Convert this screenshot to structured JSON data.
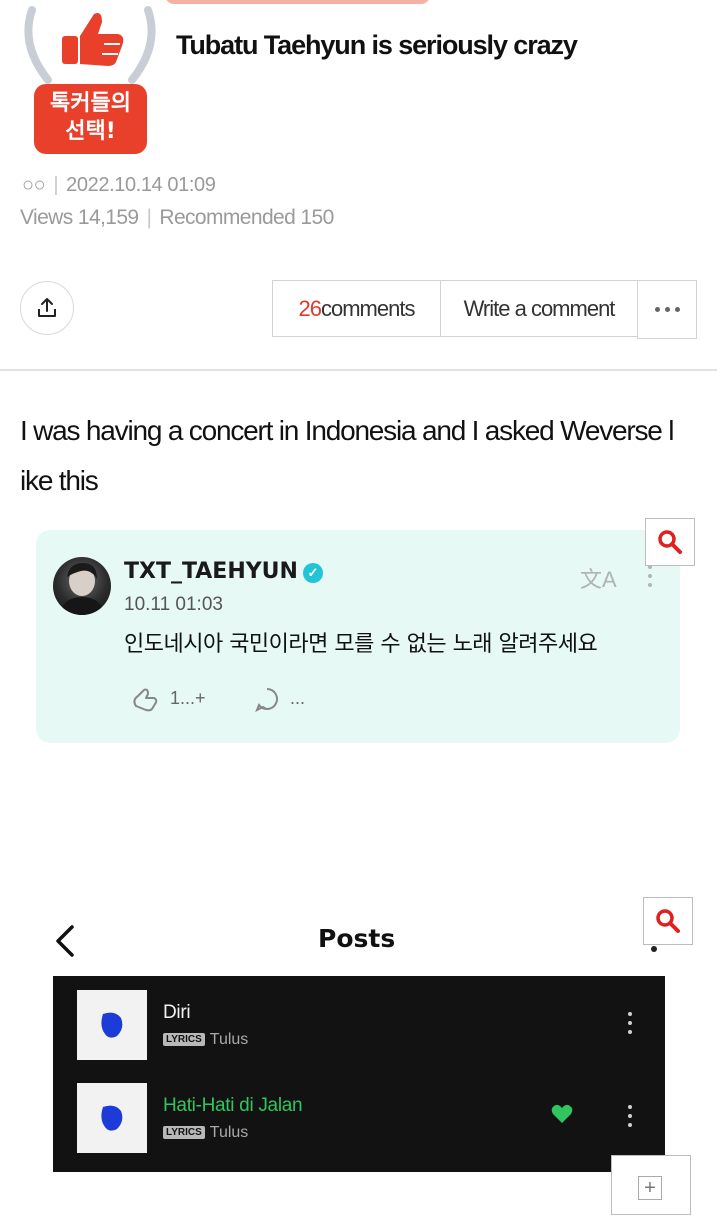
{
  "post": {
    "badge_text_line1": "톡커들의",
    "badge_text_line2": "선택!",
    "title": "Tubatu Taehyun is seriously crazy",
    "author": "○○",
    "datetime": "2022.10.14 01:09",
    "views_label": "Views 14,159",
    "recommended_label": "Recommended 150",
    "body_line1": "I was having a concert in Indonesia and I asked Weverse l",
    "body_line2": "ike this"
  },
  "actions": {
    "comment_count": "26",
    "comments_label": "comments",
    "write_comment_label": "Write a comment"
  },
  "weverse_card": {
    "username": "TXT_TAEHYUN",
    "timestamp": "10.11 01:03",
    "text": "인도네시아 국민이라면 모를 수 없는 노래 알려주세요",
    "likes": "1...+",
    "comments": "..."
  },
  "music_screen": {
    "title": "Posts",
    "tracks": [
      {
        "title": "Diri",
        "tag": "LYRICS",
        "artist": "Tulus",
        "liked": false
      },
      {
        "title": "Hati-Hati di Jalan",
        "tag": "LYRICS",
        "artist": "Tulus",
        "liked": true
      }
    ]
  },
  "icons": {
    "share": "share-icon",
    "zoom": "magnifier-icon",
    "back": "chevron-left-icon",
    "more": "more-icon",
    "translate": "translate-icon",
    "heart": "heart-icon",
    "plus": "plus-icon"
  },
  "colors": {
    "accent_red": "#e9402c",
    "comment_count": "#e03a2e",
    "card_bg": "#e6f9f4",
    "liked_green": "#30c55e"
  }
}
